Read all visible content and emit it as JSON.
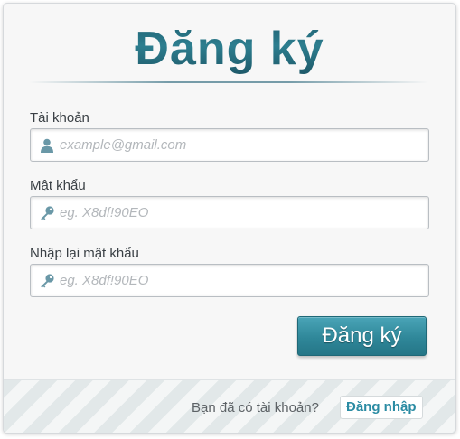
{
  "form": {
    "title": "Đăng ký",
    "fields": [
      {
        "label": "Tài khoản",
        "placeholder": "example@gmail.com",
        "value": "",
        "icon": "user-icon"
      },
      {
        "label": "Mật khẩu",
        "placeholder": "eg. X8df!90EO",
        "value": "",
        "icon": "key-icon"
      },
      {
        "label": "Nhập lại mật khẩu",
        "placeholder": "eg. X8df!90EO",
        "value": "",
        "icon": "key-icon"
      }
    ],
    "submit_label": "Đăng ký"
  },
  "footer": {
    "prompt": "Bạn đã có tài khoản?",
    "login_label": "Đăng nhập"
  },
  "colors": {
    "accent": "#2f8799",
    "title": "#2b6f80",
    "link": "#2a8ba3",
    "icon": "#6a98a7"
  }
}
